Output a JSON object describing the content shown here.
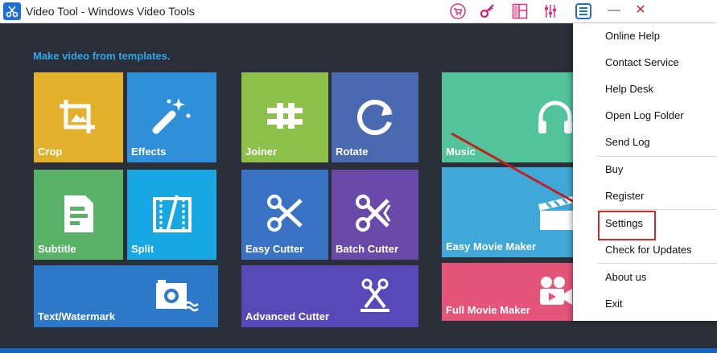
{
  "window": {
    "title": "Video Tool - Windows Video Tools",
    "minimize_label": "—",
    "close_label": "✕"
  },
  "main": {
    "heading": "Make video from templates."
  },
  "tiles": {
    "crop": "Crop",
    "effects": "Effects",
    "subtitle": "Subtitle",
    "split": "Split",
    "text_watermark": "Text/Watermark",
    "joiner": "Joiner",
    "rotate": "Rotate",
    "easy_cutter": "Easy Cutter",
    "batch_cutter": "Batch Cutter",
    "advanced_cutter": "Advanced Cutter",
    "music": "Music",
    "easy_movie_maker": "Easy Movie Maker",
    "full_movie_maker": "Full Movie Maker"
  },
  "menu": {
    "items": [
      "Online Help",
      "Contact Service",
      "Help Desk",
      "Open Log Folder",
      "Send Log",
      "Buy",
      "Register",
      "Settings",
      "Check for Updates",
      "About us",
      "Exit"
    ]
  },
  "colors": {
    "background": "#2b2f3a",
    "heading": "#2ea7ea",
    "crop": "#e2b02a",
    "effects": "#2f8fd8",
    "subtitle": "#5ab168",
    "split": "#17a7e2",
    "text_watermark": "#2e78c8",
    "joiner": "#8cc04a",
    "rotate": "#4b69b0",
    "easy_cutter": "#3b73c4",
    "batch_cutter": "#6a4aa8",
    "advanced_cutter": "#5848b8",
    "music": "#52c39a",
    "easy_movie_maker": "#40a8d8",
    "full_movie_maker": "#e5557a",
    "highlight": "#d62828"
  },
  "icons": [
    "app-scissors-icon",
    "cart-icon",
    "key-icon",
    "layout-icon",
    "settings-sliders-icon",
    "menu-icon",
    "crop-icon",
    "magic-wand-icon",
    "subtitle-icon",
    "film-split-icon",
    "camera-water-icon",
    "joiner-icon",
    "rotate-icon",
    "scissors-icon",
    "movie-clapper-icon",
    "headphones-icon",
    "video-camera-icon"
  ]
}
